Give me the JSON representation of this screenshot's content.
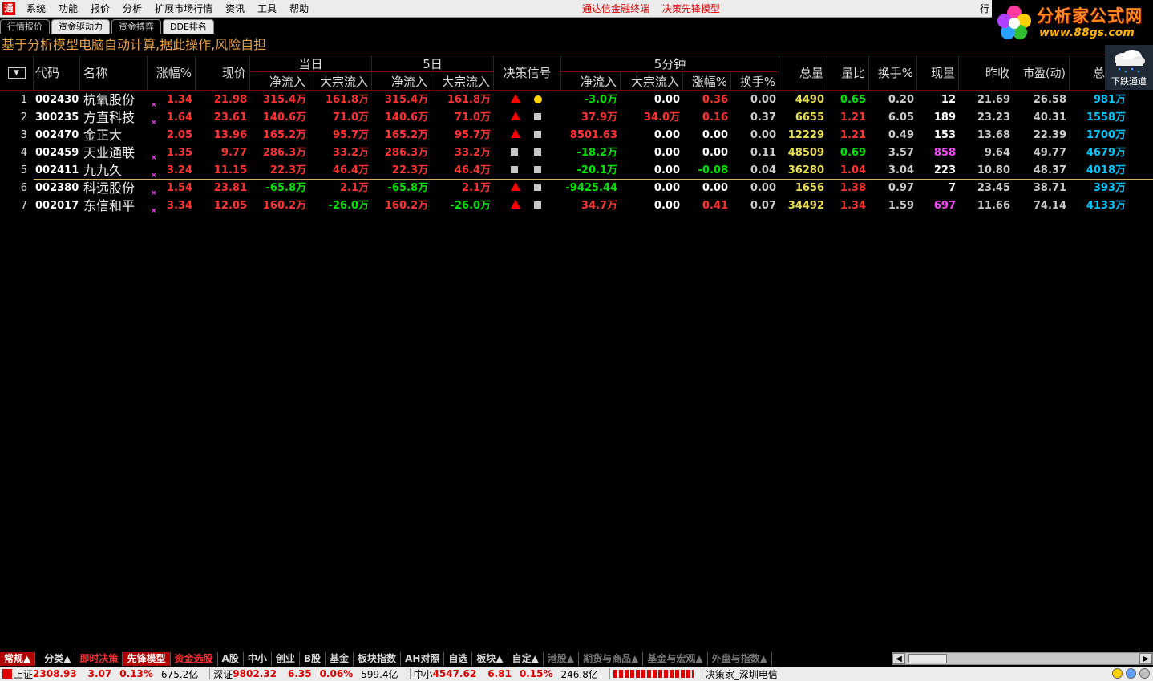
{
  "menu": {
    "items": [
      "系统",
      "功能",
      "报价",
      "分析",
      "扩展市场行情",
      "资讯",
      "工具",
      "帮助"
    ],
    "title_left": "通达信金融终端",
    "title_right": "决策先锋模型",
    "right_button": "行"
  },
  "brand": {
    "name": "分析家公式网",
    "url": "www.88gs.com"
  },
  "weather": {
    "label": "下跌通道",
    "icon": "rain-cloud-icon"
  },
  "tabs": [
    "行情报价",
    "资金驱动力",
    "资金搏弈",
    "DDE排名"
  ],
  "banner": "基于分析模型电脑自动计算,据此操作,风险自担",
  "table": {
    "headers": {
      "code": "代码",
      "name": "名称",
      "change": "涨幅%",
      "price": "现价",
      "day_group": "当日",
      "five_day_group": "5日",
      "net_inflow": "净流入",
      "block_inflow": "大宗流入",
      "signal": "决策信号",
      "five_min_group": "5分钟",
      "change5": "涨幅%",
      "turnover5": "换手%",
      "volume": "总量",
      "vol_ratio": "量比",
      "turnover": "换手%",
      "cur_vol": "现量",
      "prev_close": "昨收",
      "pe": "市盈(动)",
      "total": "总"
    },
    "rows": [
      {
        "seq": "1",
        "code": "002430",
        "name": "杭氧股份",
        "mark": "×",
        "change": "1.34",
        "price": "21.98",
        "d_net": "315.4万",
        "d_blk": "161.8万",
        "f_net": "315.4万",
        "f_blk": "161.8万",
        "sig1": "triangle",
        "sig2": "dot",
        "m_net": "-3.0万",
        "m_blk": "0.00",
        "m_chg": "0.36",
        "m_tur": "0.00",
        "vol": "4490",
        "vr": "0.65",
        "tur": "0.20",
        "cur": "12",
        "prev": "21.69",
        "pe": "26.58",
        "total": "981万"
      },
      {
        "seq": "2",
        "code": "300235",
        "name": "方直科技",
        "mark": "×",
        "change": "1.64",
        "price": "23.61",
        "d_net": "140.6万",
        "d_blk": "71.0万",
        "f_net": "140.6万",
        "f_blk": "71.0万",
        "sig1": "triangle",
        "sig2": "square",
        "m_net": "37.9万",
        "m_blk": "34.0万",
        "m_chg": "0.16",
        "m_tur": "0.37",
        "vol": "6655",
        "vr": "1.21",
        "tur": "6.05",
        "cur": "189",
        "prev": "23.23",
        "pe": "40.31",
        "total": "1558万"
      },
      {
        "seq": "3",
        "code": "002470",
        "name": "金正大",
        "mark": "",
        "change": "2.05",
        "price": "13.96",
        "d_net": "165.2万",
        "d_blk": "95.7万",
        "f_net": "165.2万",
        "f_blk": "95.7万",
        "sig1": "triangle",
        "sig2": "square",
        "m_net": "8501.63",
        "m_blk": "0.00",
        "m_chg": "0.00",
        "m_tur": "0.00",
        "vol": "12229",
        "vr": "1.21",
        "tur": "0.49",
        "cur": "153",
        "prev": "13.68",
        "pe": "22.39",
        "total": "1700万"
      },
      {
        "seq": "4",
        "code": "002459",
        "name": "天业通联",
        "mark": "×",
        "change": "1.35",
        "price": "9.77",
        "d_net": "286.3万",
        "d_blk": "33.2万",
        "f_net": "286.3万",
        "f_blk": "33.2万",
        "sig1": "square",
        "sig2": "square",
        "m_net": "-18.2万",
        "m_blk": "0.00",
        "m_chg": "0.00",
        "m_tur": "0.11",
        "vol": "48509",
        "vr": "0.69",
        "tur": "3.57",
        "cur": "858",
        "prev": "9.64",
        "pe": "49.77",
        "total": "4679万"
      },
      {
        "seq": "5",
        "code": "002411",
        "name": "九九久",
        "mark": "×",
        "change": "3.24",
        "price": "11.15",
        "d_net": "22.3万",
        "d_blk": "46.4万",
        "f_net": "22.3万",
        "f_blk": "46.4万",
        "sig1": "square",
        "sig2": "square",
        "m_net": "-20.1万",
        "m_blk": "0.00",
        "m_chg": "-0.08",
        "m_tur": "0.04",
        "vol": "36280",
        "vr": "1.04",
        "tur": "3.04",
        "cur": "223",
        "prev": "10.80",
        "pe": "48.37",
        "total": "4018万"
      },
      {
        "seq": "6",
        "code": "002380",
        "name": "科远股份",
        "mark": "×",
        "change": "1.54",
        "price": "23.81",
        "d_net": "-65.8万",
        "d_blk": "2.1万",
        "f_net": "-65.8万",
        "f_blk": "2.1万",
        "sig1": "triangle",
        "sig2": "square",
        "m_net": "-9425.44",
        "m_blk": "0.00",
        "m_chg": "0.00",
        "m_tur": "0.00",
        "vol": "1656",
        "vr": "1.38",
        "tur": "0.97",
        "cur": "7",
        "prev": "23.45",
        "pe": "38.71",
        "total": "393万"
      },
      {
        "seq": "7",
        "code": "002017",
        "name": "东信和平",
        "mark": "×",
        "change": "3.34",
        "price": "12.05",
        "d_net": "160.2万",
        "d_blk": "-26.0万",
        "f_net": "160.2万",
        "f_blk": "-26.0万",
        "sig1": "triangle",
        "sig2": "square",
        "m_net": "34.7万",
        "m_blk": "0.00",
        "m_chg": "0.41",
        "m_tur": "0.07",
        "vol": "34492",
        "vr": "1.34",
        "tur": "1.59",
        "cur": "697",
        "prev": "11.66",
        "pe": "74.14",
        "total": "4133万"
      }
    ]
  },
  "category_tabs": [
    "常规▲",
    "分类▲",
    "即时决策",
    "先锋模型",
    "资金选股",
    "A股",
    "中小",
    "创业",
    "B股",
    "基金",
    "板块指数",
    "AH对照",
    "自选",
    "板块▲",
    "自定▲",
    "港股▲",
    "期货与商品▲",
    "基金与宏观▲",
    "外盘与指数▲"
  ],
  "status": {
    "sh_label": "上证",
    "sh_index": "2308.93",
    "sh_chg": "3.07",
    "sh_pct": "0.13%",
    "sh_amt": "675.2亿",
    "sz_label": "深证",
    "sz_index": "9802.32",
    "sz_chg": "6.35",
    "sz_pct": "0.06%",
    "sz_amt": "599.4亿",
    "zx_label": "中小",
    "zx_index": "4547.62",
    "zx_chg": "6.81",
    "zx_pct": "0.15%",
    "zx_amt": "246.8亿",
    "server": "决策家_深圳电信"
  },
  "colors": {
    "up": "#ff3232",
    "down": "#00e600",
    "accent": "#b00000",
    "banner": "#e8a040"
  }
}
